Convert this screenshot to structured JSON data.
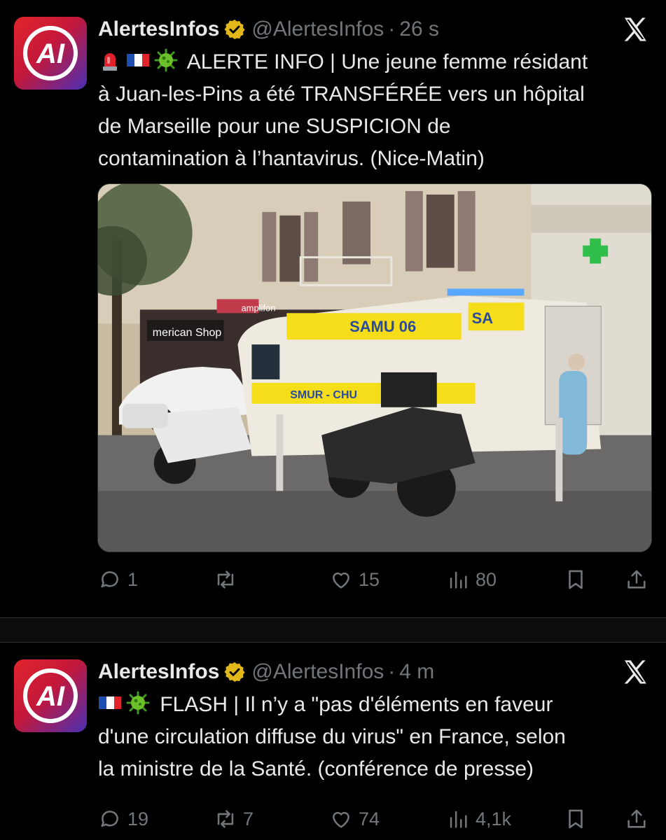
{
  "tweets": [
    {
      "name": "AlertesInfos",
      "handle": "@AlertesInfos",
      "separator": "·",
      "time": "26 s",
      "line1": "ALERTE INFO | Une jeune femme résidant",
      "line2": "à Juan-les-Pins a été TRANSFÉRÉE vers un hôpital",
      "line3": "de Marseille pour une SUSPICION de",
      "line4": "contamination à l’hantavirus. (Nice-Matin)",
      "emojis": [
        "siren-emoji",
        "french-flag-emoji",
        "microbe-emoji"
      ],
      "photo_text": {
        "ambulance_top": "SAMU 06",
        "ambulance_side": "SA",
        "ambulance_body": "SMUR - CHU",
        "shop_sign": "amplifon",
        "shop_sign2": "merican Shop"
      },
      "stats": {
        "replies": "1",
        "reposts": "",
        "likes": "15",
        "views": "80"
      }
    },
    {
      "name": "AlertesInfos",
      "handle": "@AlertesInfos",
      "separator": "·",
      "time": "4 m",
      "line1": "FLASH | Il n’y a \"pas d'éléments en faveur",
      "line2": "d'une circulation diffuse du virus\" en France, selon",
      "line3": "la ministre de la Santé. (conférence de presse)",
      "emojis": [
        "french-flag-emoji",
        "microbe-emoji"
      ],
      "stats": {
        "replies": "19",
        "reposts": "7",
        "likes": "74",
        "views": "4,1k"
      }
    }
  ],
  "icons": [
    "reply-icon",
    "repost-icon",
    "like-icon",
    "views-icon",
    "bookmark-icon",
    "share-icon",
    "x-logo-icon",
    "verified-badge-icon"
  ],
  "colors": {
    "background": "#000000",
    "text": "#e7e9ea",
    "muted": "#71767b",
    "verified": "#e2b719",
    "avatar_red": "#e2252b",
    "avatar_purple": "#4a2fb4"
  }
}
